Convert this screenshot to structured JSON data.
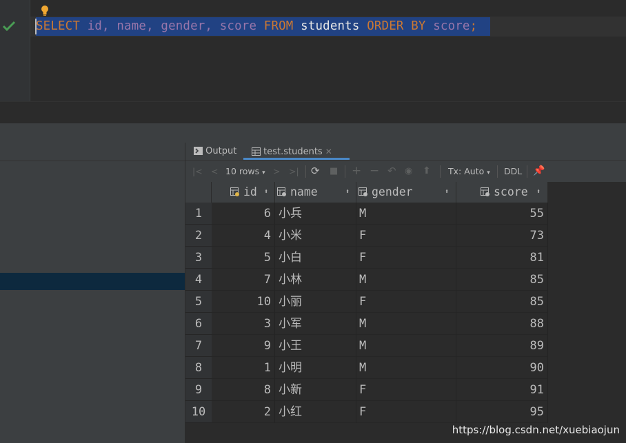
{
  "editor": {
    "sql": {
      "kw_select": "SELECT",
      "columns": "id, name, gender, score",
      "kw_from": "FROM",
      "table": "students",
      "kw_order": "ORDER BY",
      "order_col": "score",
      "terminator": ";"
    }
  },
  "result": {
    "tabs": [
      {
        "label": "Output"
      },
      {
        "label": "test.students"
      }
    ],
    "toolbar": {
      "rows": "10 rows",
      "tx": "Tx: Auto",
      "ddl": "DDL"
    },
    "columns": [
      "id",
      "name",
      "gender",
      "score"
    ],
    "rows": [
      {
        "n": "1",
        "id": "6",
        "name": "小兵",
        "gender": "M",
        "score": "55"
      },
      {
        "n": "2",
        "id": "4",
        "name": "小米",
        "gender": "F",
        "score": "73"
      },
      {
        "n": "3",
        "id": "5",
        "name": "小白",
        "gender": "F",
        "score": "81"
      },
      {
        "n": "4",
        "id": "7",
        "name": "小林",
        "gender": "M",
        "score": "85"
      },
      {
        "n": "5",
        "id": "10",
        "name": "小丽",
        "gender": "F",
        "score": "85"
      },
      {
        "n": "6",
        "id": "3",
        "name": "小军",
        "gender": "M",
        "score": "88"
      },
      {
        "n": "7",
        "id": "9",
        "name": "小王",
        "gender": "M",
        "score": "89"
      },
      {
        "n": "8",
        "id": "1",
        "name": "小明",
        "gender": "M",
        "score": "90"
      },
      {
        "n": "9",
        "id": "8",
        "name": "小新",
        "gender": "F",
        "score": "91"
      },
      {
        "n": "10",
        "id": "2",
        "name": "小红",
        "gender": "F",
        "score": "95"
      }
    ]
  },
  "watermark": "https://blog.csdn.net/xuebiaojun",
  "colors": {
    "keyword": "#cc7832",
    "column": "#9876aa",
    "selection": "#214283",
    "success": "#499c54",
    "accent_tab": "#4a88c7"
  }
}
